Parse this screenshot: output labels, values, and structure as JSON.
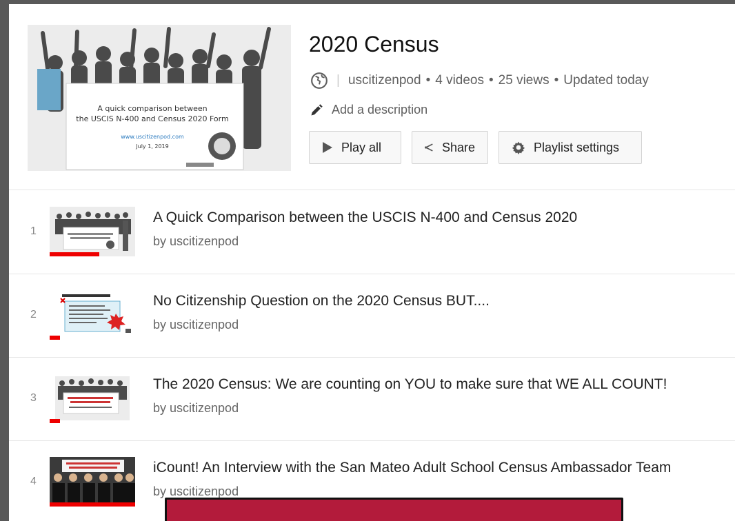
{
  "playlist": {
    "title": "2020 Census",
    "channel": "uscitizenpod",
    "video_count": "4 videos",
    "views": "25 views",
    "updated": "Updated today",
    "separator": "|",
    "dot": "•",
    "add_description": "Add a description",
    "hero_caption_line1": "A quick comparison between",
    "hero_caption_line2": "the USCIS N-400 and Census 2020 Form",
    "hero_caption_url": "www.uscitizenpod.com",
    "hero_caption_date": "July 1, 2019"
  },
  "buttons": {
    "play_all": "Play all",
    "share": "Share",
    "settings": "Playlist settings"
  },
  "videos": [
    {
      "index": "1",
      "title": "A Quick Comparison between the USCIS N-400 and Census 2020",
      "byline": "by uscitizenpod",
      "progress": 0.58
    },
    {
      "index": "2",
      "title": "No Citizenship Question on the 2020 Census BUT....",
      "byline": "by uscitizenpod",
      "progress": 0.12
    },
    {
      "index": "3",
      "title": "The 2020 Census: We are counting on YOU to make sure that WE ALL COUNT!",
      "byline": "by uscitizenpod",
      "progress": 0.12
    },
    {
      "index": "4",
      "title": "iCount! An Interview with the San Mateo Adult School Census Ambassador Team",
      "byline": "by uscitizenpod",
      "progress": 1.0
    }
  ],
  "colors": {
    "progress": "#ee0000",
    "overlay": "#b31b3b"
  },
  "icons": {
    "visibility": "globe-icon",
    "edit": "pencil-icon",
    "play": "play-icon",
    "share": "share-icon",
    "settings": "gear-icon"
  }
}
